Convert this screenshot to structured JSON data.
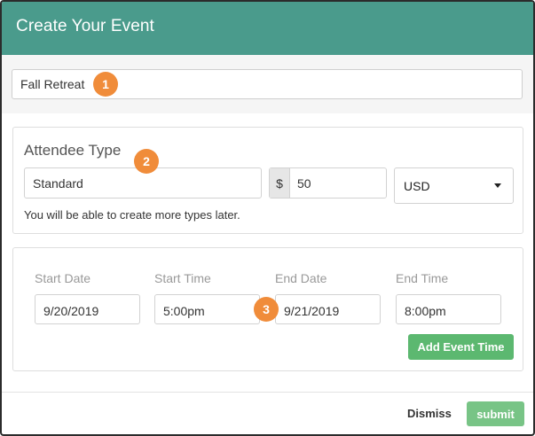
{
  "header": {
    "title": "Create Your Event"
  },
  "event": {
    "name_value": "Fall Retreat"
  },
  "attendee": {
    "section_title": "Attendee Type",
    "type_value": "Standard",
    "currency_symbol": "$",
    "price_value": "50",
    "currency_selected": "USD",
    "help_text": "You will be able to create more types later."
  },
  "time": {
    "labels": {
      "start_date": "Start Date",
      "start_time": "Start Time",
      "end_date": "End Date",
      "end_time": "End Time"
    },
    "values": {
      "start_date": "9/20/2019",
      "start_time": "5:00pm",
      "end_date": "9/21/2019",
      "end_time": "8:00pm"
    },
    "add_label": "Add Event Time"
  },
  "footer": {
    "dismiss_label": "Dismiss",
    "submit_label": "submit"
  },
  "badges": [
    "1",
    "2",
    "3"
  ],
  "colors": {
    "header_bg": "#4a9b8c",
    "badge": "#f08c3a",
    "add_button": "#5cb870",
    "submit_button": "#78c486"
  }
}
